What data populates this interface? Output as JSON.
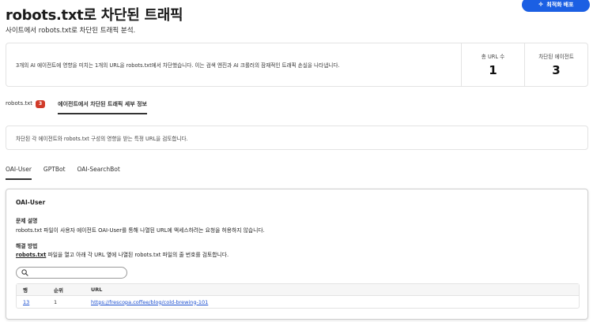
{
  "header": {
    "title": "robots.txt로 차단된 트래픽",
    "subtitle": "사이트에서 robots.txt로 차단된 트래픽 분석.",
    "optimize_label": "최적화 배포"
  },
  "summary": {
    "text": "3개의 AI 에이전트에 영향을 미치는 1개의 URL을 robots.txt에서 차단했습니다. 이는 검색 엔진과 AI 크롤러의 잠재적인 트래픽 손실을 나타냅니다.",
    "stats": [
      {
        "label": "총 URL 수",
        "value": "1"
      },
      {
        "label": "차단된 에이전트",
        "value": "3"
      }
    ]
  },
  "tabs_top": [
    {
      "label": "robots.txt",
      "badge": "3"
    },
    {
      "label": "에이전트에서 차단된 트래픽 세부 정보"
    }
  ],
  "info": {
    "text": "차단된 각 에이전트와 robots.txt 구성의 영향을 받는 특정 URL을 검토합니다."
  },
  "agent_tabs": [
    "OAI-User",
    "GPTBot",
    "OAI-SearchBot"
  ],
  "detail": {
    "title": "OAI-User",
    "problem_heading": "문제 설명",
    "problem_text": "robots.txt 파일이 사용자 에이전트 OAI-User를 통해 나열된 URL에 액세스하려는 요청을 허용하지 않습니다.",
    "fix_heading": "해결 방법",
    "fix_link": "robots.txt",
    "fix_text": " 파일을 열고 아래 각 URL 옆에 나열된 robots.txt 파일의 줄 번호를 검토합니다.",
    "search_placeholder": "",
    "table": {
      "headers": [
        "행",
        "순위",
        "URL"
      ],
      "rows": [
        {
          "line": "13",
          "rank": "1",
          "url": "https://frescopa.coffee/blog/cold-brewing-101"
        }
      ]
    }
  },
  "colors": {
    "accent": "#1b5fe3",
    "badge": "#d13b2a",
    "link": "#1b4fd0"
  }
}
